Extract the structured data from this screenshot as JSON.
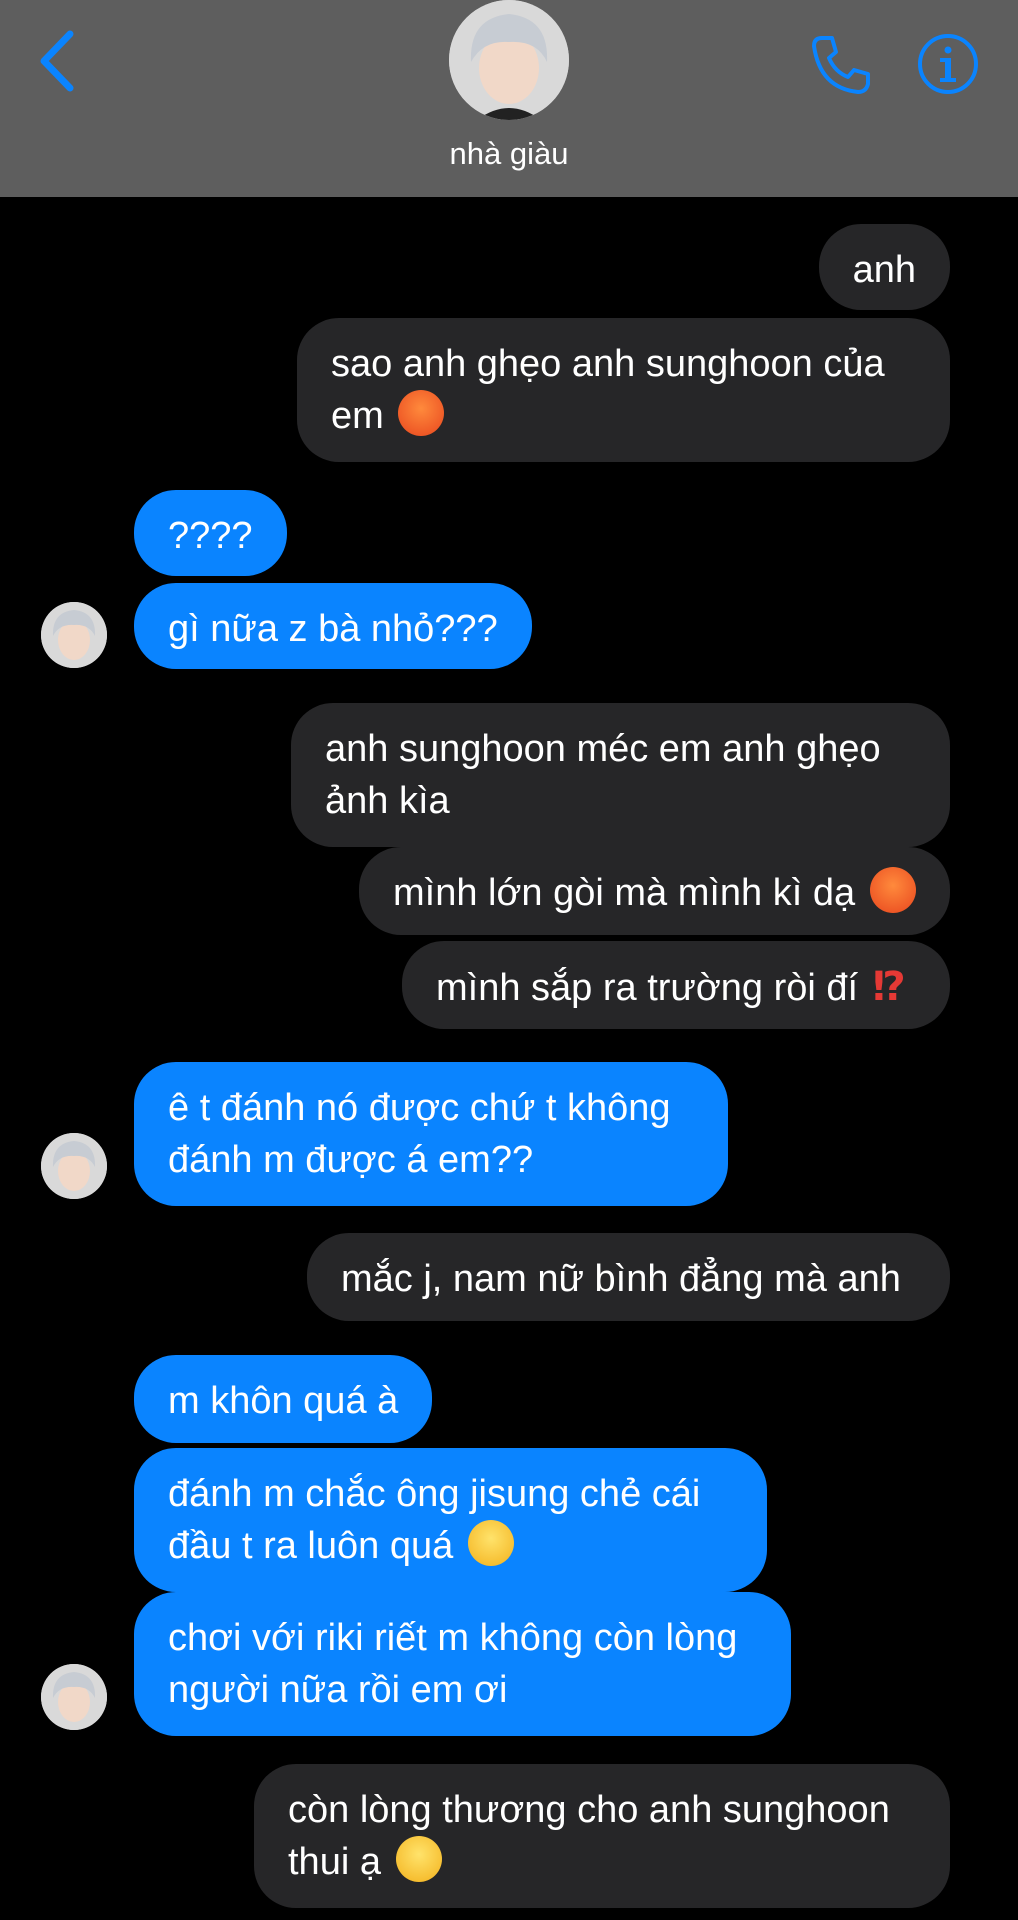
{
  "header": {
    "contact_name": "nhà giàu",
    "back_icon": "chevron-left-icon",
    "call_icon": "phone-icon",
    "info_icon": "info-icon",
    "accent_color": "#0a84ff",
    "header_bg": "#5e5e5e"
  },
  "colors": {
    "sent_bubble": "#262628",
    "received_bubble": "#0a84ff",
    "background": "#000000"
  },
  "messages": [
    {
      "side": "sent",
      "text": "anh"
    },
    {
      "side": "sent",
      "text": "sao anh ghẹo anh sunghoon của em",
      "emoji": "angry-face"
    },
    {
      "side": "received",
      "text": "????"
    },
    {
      "side": "received",
      "text": "gì nữa z bà nhỏ???"
    },
    {
      "side": "sent",
      "text": "anh sunghoon méc em anh ghẹo ảnh kìa"
    },
    {
      "side": "sent",
      "text": "mình lớn gòi mà mình kì dạ",
      "emoji": "angry-face"
    },
    {
      "side": "sent",
      "text": "mình sắp ra trường ròi đí",
      "emoji": "⁉️"
    },
    {
      "side": "received",
      "text": "ê t đánh nó được chứ t không đánh m được á em??"
    },
    {
      "side": "sent",
      "text": "mắc j, nam nữ bình đẳng mà anh"
    },
    {
      "side": "received",
      "text": "m khôn quá à"
    },
    {
      "side": "received",
      "text": "đánh m chắc ông jisung chẻ cái đầu t ra luôn quá",
      "emoji": "smiling-face"
    },
    {
      "side": "received",
      "text": "chơi với riki riết m không còn lòng người nữa rồi em ơi"
    },
    {
      "side": "sent",
      "text": "còn lòng thương cho anh sunghoon thui ạ",
      "emoji": "kissing-face"
    }
  ]
}
